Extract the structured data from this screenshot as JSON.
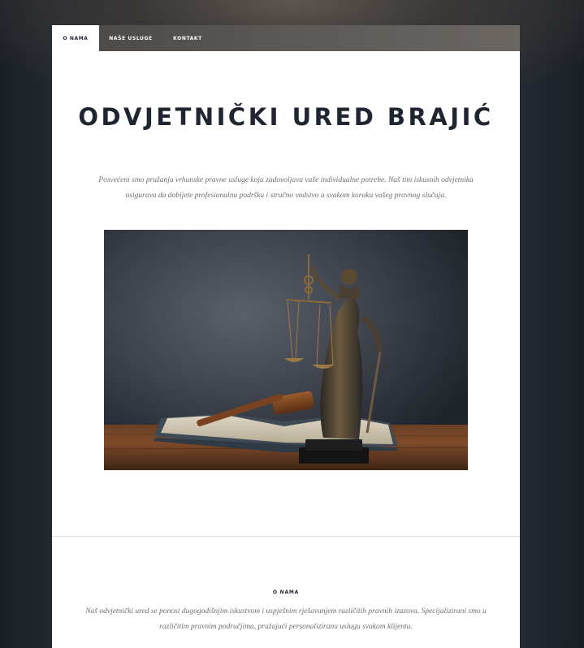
{
  "nav": {
    "items": [
      {
        "label": "O NAMA",
        "active": true
      },
      {
        "label": "NAŠE USLUGE",
        "active": false
      },
      {
        "label": "KONTAKT",
        "active": false
      }
    ]
  },
  "header": {
    "title": "ODVJETNIČKI URED BRAJIĆ",
    "intro": "Posvećeni smo pružanju vrhunske pravne usluge koja zadovoljava vaše individualne potrebe. Naš tim iskusnih odvjetnika osigurava da dobijete profesionalnu podršku i stručno vodstvo u svakom koraku vašeg pravnog slučaja."
  },
  "hero": {
    "image": "lady-justice-statue-gavel-book"
  },
  "about": {
    "label": "O NAMA",
    "text": "Naš odvjetnički ured se ponosi dugogodišnjim iskustvom i uspješnim rješavanjem različitih pravnih izazova. Specijalizirani smo u različitim pravnim područjima, pružajući personaliziranu uslugu svakom klijentu."
  },
  "colors": {
    "heading": "#202631",
    "nav_bg": "#5c5855",
    "text_muted": "#6a6e74"
  }
}
